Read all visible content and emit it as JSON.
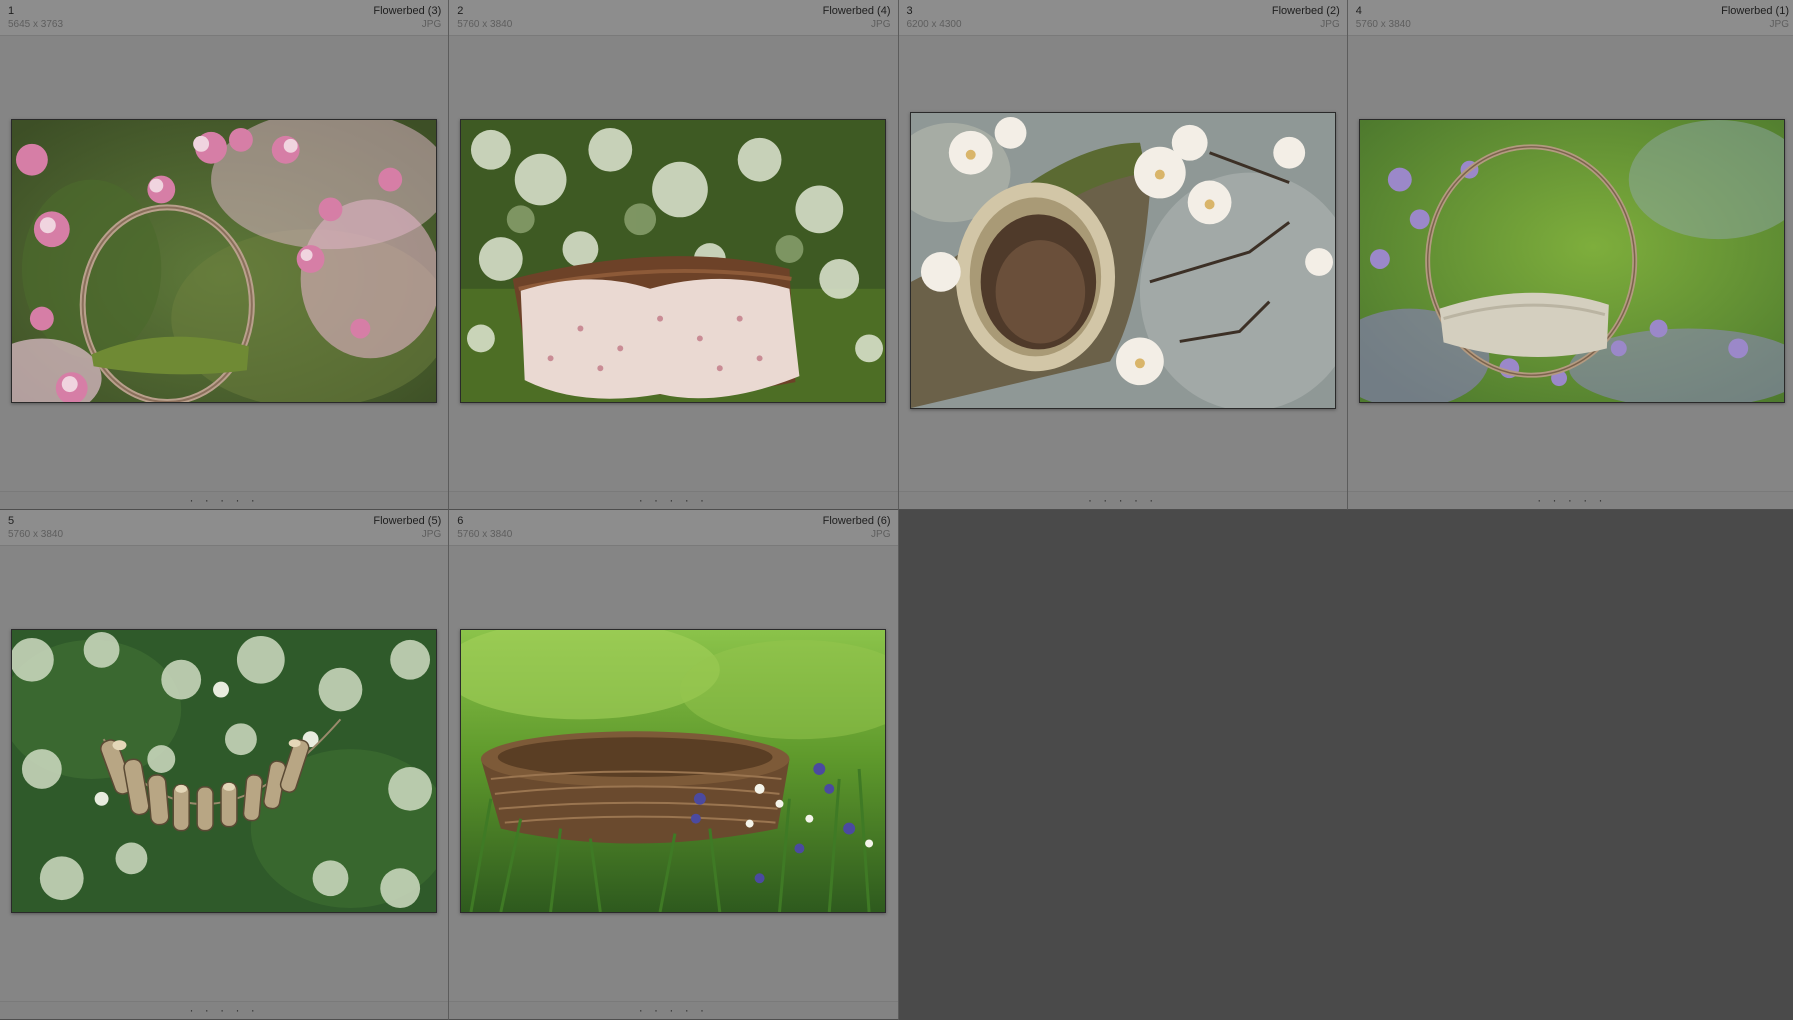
{
  "grid": {
    "cells": [
      {
        "index": "1",
        "name": "Flowerbed (3)",
        "dims": "5645 x 3763",
        "ext": "JPG",
        "rating": "· · · · ·",
        "thumb_subject": "pink-magnolia-hoop-swing"
      },
      {
        "index": "2",
        "name": "Flowerbed (4)",
        "dims": "5760 x 3840",
        "ext": "JPG",
        "rating": "· · · · ·",
        "thumb_subject": "white-blossom-basket-bed"
      },
      {
        "index": "3",
        "name": "Flowerbed (2)",
        "dims": "6200 x 4300",
        "ext": "JPG",
        "rating": "· · · · ·",
        "thumb_subject": "white-magnolia-tree-hollow"
      },
      {
        "index": "4",
        "name": "Flowerbed (1)",
        "dims": "5760 x 3840",
        "ext": "JPG",
        "rating": "· · · · ·",
        "thumb_subject": "lilac-hoop-swing"
      },
      {
        "index": "5",
        "name": "Flowerbed (5)",
        "dims": "5760 x 3840",
        "ext": "JPG",
        "rating": "· · · · ·",
        "thumb_subject": "log-hammock-white-flowers"
      },
      {
        "index": "6",
        "name": "Flowerbed (6)",
        "dims": "5760 x 3840",
        "ext": "JPG",
        "rating": "· · · · ·",
        "thumb_subject": "wicker-basket-in-grass"
      }
    ]
  },
  "colors": {
    "background": "#4a4a4a",
    "cell": "#858585",
    "header": "#8d8d8d"
  }
}
